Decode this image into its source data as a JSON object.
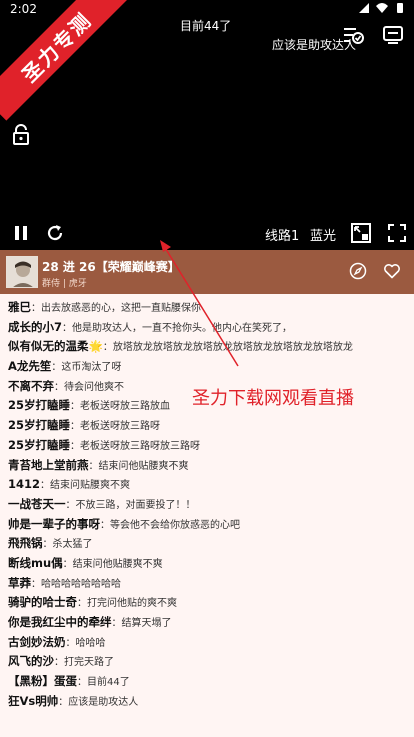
{
  "status_bar": {
    "time": "2:02"
  },
  "danmaku": [
    "目前44了",
    "应该是助攻达人"
  ],
  "watermark": {
    "ribbon_text": "圣力专测",
    "promo_text": "圣力下载网观看直播",
    "color": "#e0222a"
  },
  "player": {
    "line_label": "线路1",
    "quality_label": "蓝光",
    "icons": [
      "settings-icon",
      "cast-icon",
      "lock-icon",
      "pause-icon",
      "refresh-icon",
      "pip-icon",
      "fullscreen-icon"
    ]
  },
  "room": {
    "title": "28 进 26【荣耀巅峰赛】",
    "subtitle": "群侍 | 虎牙",
    "header_color": "#9b5a40"
  },
  "chat": [
    {
      "name": "雅巳",
      "msg": "出去放惑恶的心，这把一直贴腰保你"
    },
    {
      "name": "成长的小7",
      "msg": "他是助攻达人，一直不抢你头。他内心在笑死了，"
    },
    {
      "name": "似有似无的温柔🌟",
      "msg": "放塔放龙放塔放龙放塔放龙放塔放龙放塔放龙放塔放龙"
    },
    {
      "name": "A龙先笙",
      "msg": "这币淘汰了呀"
    },
    {
      "name": "不离不弃",
      "msg": "待会问他爽不"
    },
    {
      "name": "25岁打瞌睡",
      "msg": "老板送呀放三路放血"
    },
    {
      "name": "25岁打瞌睡",
      "msg": "老板送呀放三路呀"
    },
    {
      "name": "25岁打瞌睡",
      "msg": "老板送呀放三路呀放三路呀"
    },
    {
      "name": "青苔地上堂前燕",
      "msg": "结束问他贴腰爽不爽"
    },
    {
      "name": "1412",
      "msg": "结束问贴腰爽不爽"
    },
    {
      "name": "一战苍天一",
      "msg": "不放三路，对面要投了！！"
    },
    {
      "name": "帅是一辈子的事呀",
      "msg": "等会他不会给你放惑恶的心吧"
    },
    {
      "name": "飛飛锅",
      "msg": "杀太猛了"
    },
    {
      "name": "断线mu偶",
      "msg": "结束问他贴腰爽不爽"
    },
    {
      "name": "草莽",
      "msg": "哈哈哈哈哈哈哈哈"
    },
    {
      "name": "骑驴的哈士奇",
      "msg": "打完问他贴的爽不爽"
    },
    {
      "name": "你是我红尘中的牵绊",
      "msg": "结算天塌了"
    },
    {
      "name": "古剑妙法奶",
      "msg": "哈哈哈"
    },
    {
      "name": "风飞的沙",
      "msg": "打完天路了"
    },
    {
      "name": "【黑粉】蛋蛋",
      "msg": "目前44了"
    },
    {
      "name": "狂Vs明帅",
      "msg": "应该是助攻达人"
    }
  ]
}
